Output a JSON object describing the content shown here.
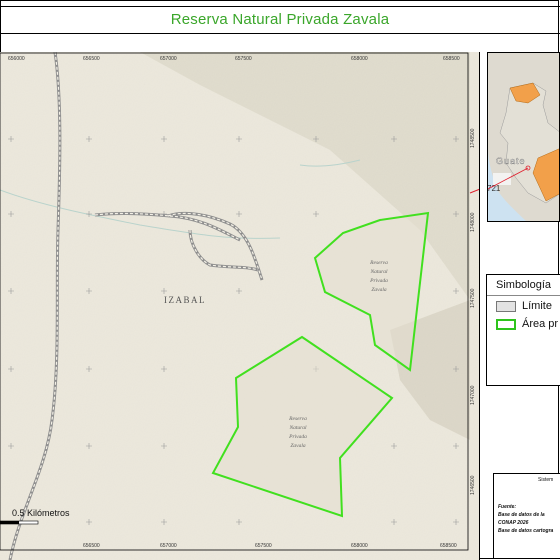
{
  "title": "Reserva Natural Privada Zavala",
  "map": {
    "x_ticks_top": [
      "656000",
      "656500",
      "657000",
      "657500",
      "658000",
      "658500"
    ],
    "x_ticks_bottom": [
      "656500",
      "657000",
      "657500",
      "658000",
      "658500"
    ],
    "y_ticks": [
      "1748500",
      "1748000",
      "1747500",
      "1747000",
      "1746500"
    ],
    "region_label": "IZABAL",
    "reserve_label_north": [
      "Reserva",
      "Natural",
      "Privada",
      "Zavala"
    ],
    "reserve_label_south": [
      "Reserva",
      "Natural",
      "Privada",
      "Zavala"
    ],
    "scale_label": "0.5 Kilómetros"
  },
  "inset": {
    "country_label": "Guate",
    "callout_label": "721"
  },
  "legend": {
    "title": "Simbología",
    "items": [
      {
        "label": "Límite",
        "fill": "#e3e3e3",
        "stroke": "#777777"
      },
      {
        "label": "Área pr",
        "fill": "#ffffff",
        "stroke": "#2ec41c"
      }
    ]
  },
  "source": {
    "sistema": "Sistem",
    "fuente": "Fuente:",
    "line1": "Base de datos de la",
    "line2": "CONAP 2026",
    "line3": "Base de datos cartogra"
  },
  "colors": {
    "title": "#3aa62a",
    "reserve_outline": "#41e01f",
    "terrain": "#e9e4d6",
    "road": "#9a9a9a",
    "river": "#b9d3cc"
  }
}
